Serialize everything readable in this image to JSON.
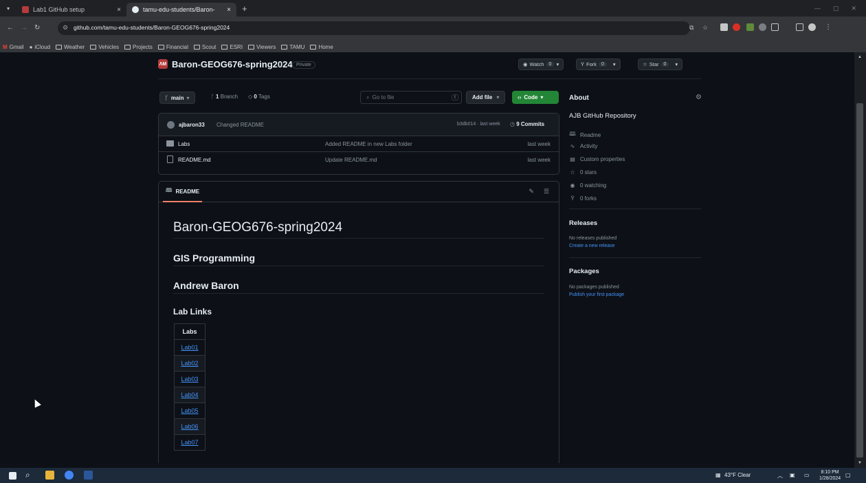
{
  "browser": {
    "tabs": [
      {
        "label": "Lab1 GitHub setup",
        "active": false,
        "favicon_color": "#b43b3b"
      },
      {
        "label": "tamu-edu-students/Baron-",
        "active": true,
        "favicon_color": "#e6edf3"
      }
    ],
    "close_glyph": "×",
    "newtab_glyph": "+",
    "url": "github.com/tamu-edu-students/Baron-GEOG676-spring2024",
    "bookmarks": [
      "Gmail",
      "iCloud",
      "Weather",
      "Vehicles",
      "Projects",
      "Financial",
      "Scout",
      "ESRI",
      "Viewers",
      "TAMU",
      "Home"
    ]
  },
  "repo": {
    "logo_text": "ΛM",
    "name": "Baron-GEOG676-spring2024",
    "visibility": "Private",
    "watch": {
      "label": "Watch",
      "count": "0"
    },
    "fork": {
      "label": "Fork",
      "count": "0"
    },
    "star": {
      "label": "Star",
      "count": "0"
    }
  },
  "toolbar": {
    "branch": "main",
    "branches": "1",
    "branches_label": "Branch",
    "tags": "0",
    "tags_label": "Tags",
    "goto_placeholder": "Go to file",
    "goto_kbd": "t",
    "add_file": "Add file",
    "code": "Code"
  },
  "commit": {
    "user": "ajbaron33",
    "message": "Changed README",
    "hash": "b3db014 · last week",
    "count": "9 Commits"
  },
  "files": [
    {
      "name": "Labs",
      "type": "dir",
      "message": "Added README in new Labs folder",
      "date": "last week"
    },
    {
      "name": "README.md",
      "type": "file",
      "message": "Update README.md",
      "date": "last week"
    }
  ],
  "readme": {
    "tab": "README",
    "h1": "Baron-GEOG676-spring2024",
    "h2a": "GIS Programming",
    "h2b": "Andrew Baron",
    "h3": "Lab Links",
    "table_header": "Labs",
    "labs": [
      "Lab01",
      "Lab02",
      "Lab03",
      "Lab04",
      "Lab05",
      "Lab06",
      "Lab07"
    ]
  },
  "about": {
    "title": "About",
    "description": "AJB GitHub Repository",
    "items": [
      {
        "icon": "book-icon",
        "label": "Readme"
      },
      {
        "icon": "activity-icon",
        "label": "Activity"
      },
      {
        "icon": "properties-icon",
        "label": "Custom properties"
      },
      {
        "icon": "star-icon",
        "label": "0 stars"
      },
      {
        "icon": "eye-icon",
        "label": "0 watching"
      },
      {
        "icon": "fork-icon",
        "label": "0 forks"
      }
    ]
  },
  "releases": {
    "title": "Releases",
    "note": "No releases published",
    "link": "Create a new release"
  },
  "packages": {
    "title": "Packages",
    "note": "No packages published",
    "link": "Publish your first package"
  },
  "taskbar": {
    "weather": "43°F Clear",
    "time": "8:10 PM",
    "date": "1/28/2024"
  }
}
